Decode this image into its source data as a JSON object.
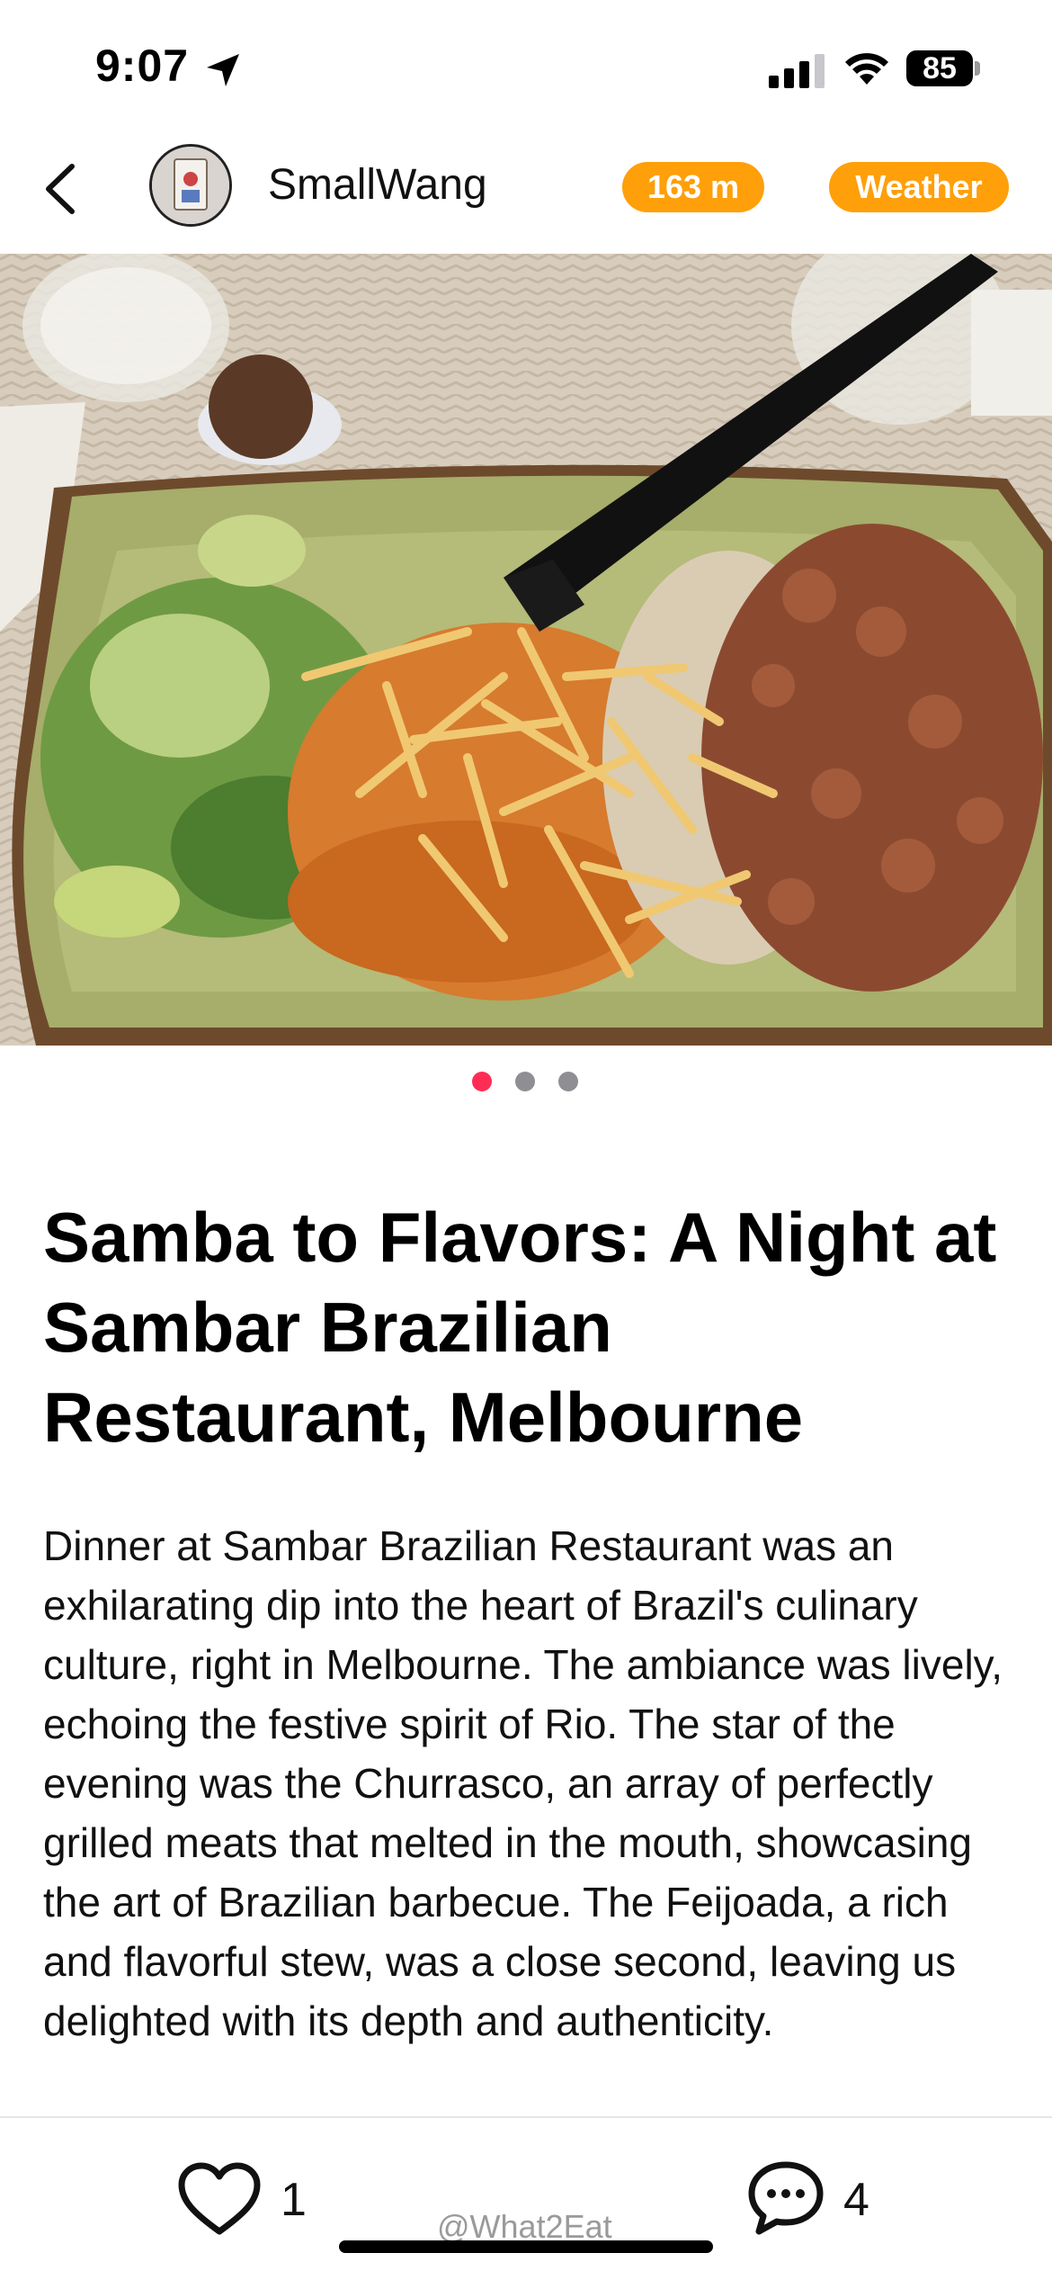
{
  "status_bar": {
    "time": "9:07",
    "battery": "85",
    "icons": [
      "location-arrow-icon",
      "signal-icon",
      "wifi-icon",
      "battery-icon"
    ]
  },
  "header": {
    "back_icon": "chevron-left-icon",
    "username": "SmallWang",
    "distance": "163 m",
    "weather": "Weather",
    "accent_color": "#ff9f0a"
  },
  "carousel": {
    "page_count": 3,
    "active_index": 0,
    "active_color": "#ff2d55",
    "inactive_color": "#8e8e93"
  },
  "post": {
    "title": "Samba to Flavors: A Night at Sambar Brazilian Restaurant, Melbourne",
    "body": "Dinner at Sambar Brazilian Restaurant was an exhilarating dip into the heart of Brazil's culinary culture, right in Melbourne. The ambiance was lively, echoing the festive spirit of Rio. The star of the evening was the Churrasco, an array of perfectly grilled meats that melted in the mouth, showcasing the art of Brazilian barbecue. The Feijoada, a rich and flavorful stew, was a close second, leaving us delighted with its depth and authenticity."
  },
  "footer": {
    "likes": "1",
    "comments": "4",
    "watermark": "@What2Eat",
    "icons": [
      "heart-icon",
      "comment-bubble-icon"
    ]
  }
}
